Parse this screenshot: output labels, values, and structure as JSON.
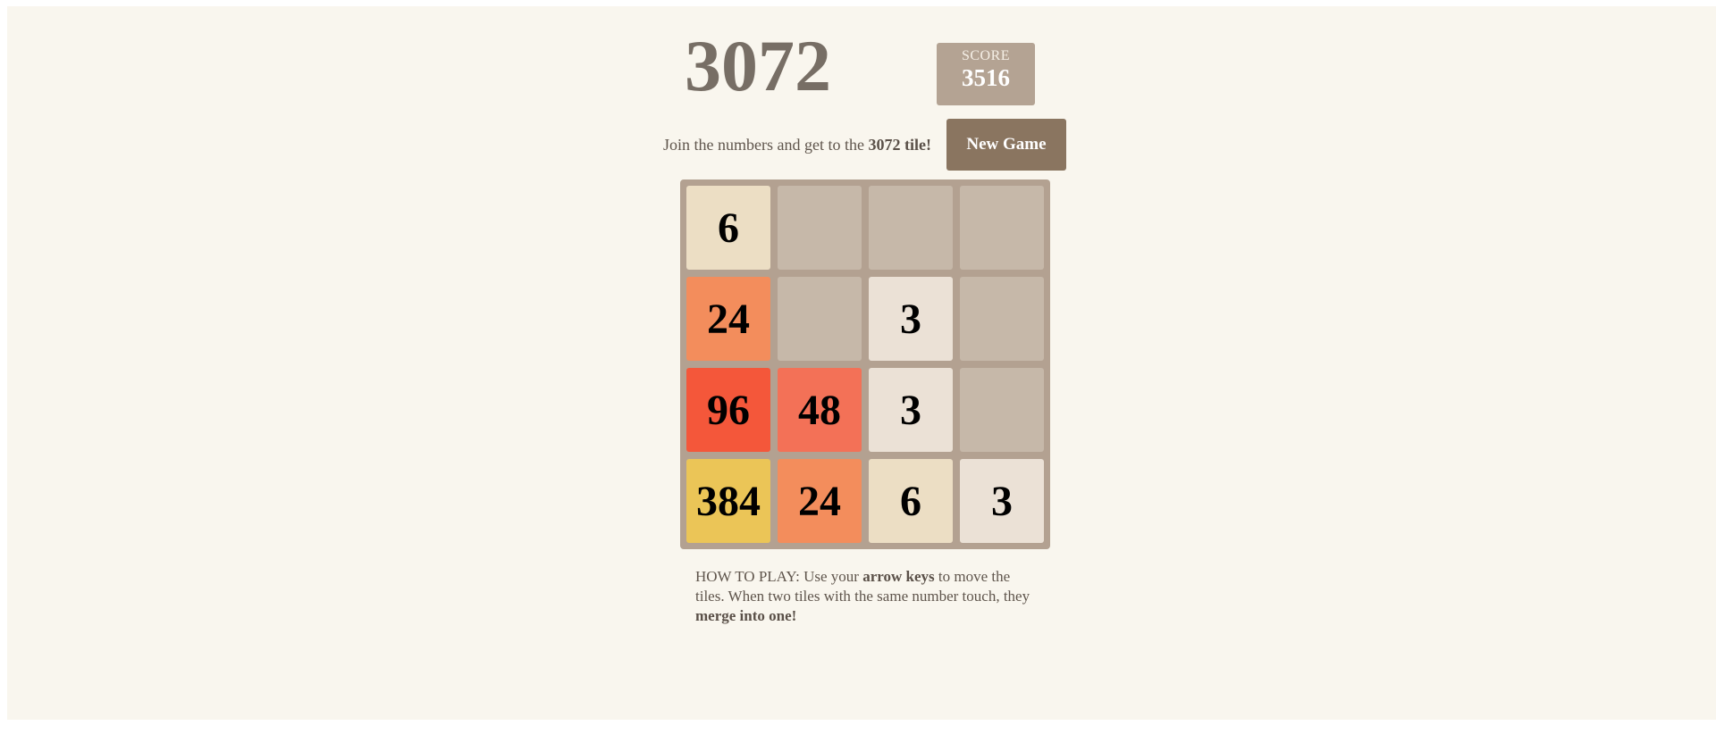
{
  "header": {
    "title": "3072",
    "score_label": "SCORE",
    "score_value": "3516"
  },
  "intro": {
    "text_before": "Join the numbers and get to the ",
    "goal_bold": "3072 tile!"
  },
  "controls": {
    "new_game_label": "New Game"
  },
  "board": {
    "rows": [
      [
        "6",
        "",
        "",
        ""
      ],
      [
        "24",
        "",
        "3",
        ""
      ],
      [
        "96",
        "48",
        "3",
        ""
      ],
      [
        "384",
        "24",
        "6",
        "3"
      ]
    ],
    "tile_colors": {
      "empty": "#c6b8a9",
      "3": "#ebe1d6",
      "6": "#ecdec4",
      "24": "#f38d5c",
      "48": "#f37157",
      "96": "#f4573a",
      "384": "#ebc557"
    }
  },
  "instructions": {
    "prefix": "HOW TO PLAY: Use your ",
    "keys_bold": "arrow keys",
    "middle": " to move the tiles. When two tiles with the same number touch, they ",
    "merge_bold": "merge into one!"
  }
}
